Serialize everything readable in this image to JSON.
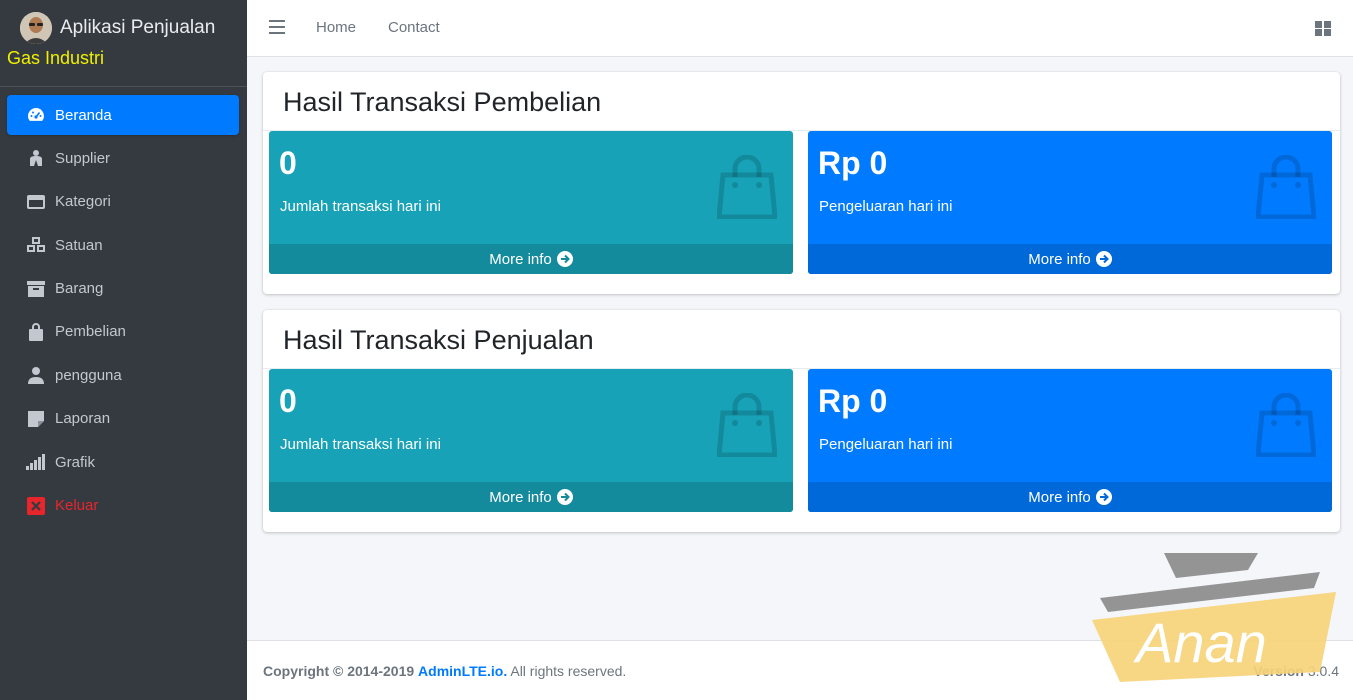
{
  "brand": {
    "title": "Aplikasi Penjualan",
    "subtitle": "Gas Industri"
  },
  "sidebar": {
    "items": [
      {
        "label": "Beranda",
        "icon": "tachometer-icon",
        "active": true
      },
      {
        "label": "Supplier",
        "icon": "user-tie-icon"
      },
      {
        "label": "Kategori",
        "icon": "window-icon"
      },
      {
        "label": "Satuan",
        "icon": "cubes-icon"
      },
      {
        "label": "Barang",
        "icon": "archive-box-icon"
      },
      {
        "label": "Pembelian",
        "icon": "shopping-bag-icon"
      },
      {
        "label": "pengguna",
        "icon": "user-icon"
      },
      {
        "label": "Laporan",
        "icon": "sticky-note-icon"
      },
      {
        "label": "Grafik",
        "icon": "signal-bars-icon"
      },
      {
        "label": "Keluar",
        "icon": "close-square-icon",
        "color": "#e8252b"
      }
    ]
  },
  "topbar": {
    "links": [
      "Home",
      "Contact"
    ]
  },
  "sections": [
    {
      "title": "Hasil Transaksi Pembelian",
      "boxes": [
        {
          "value": "0",
          "desc": "Jumlah transaksi hari ini",
          "footer": "More info",
          "color": "#17a2b8"
        },
        {
          "value": "Rp 0",
          "desc": "Pengeluaran hari ini",
          "footer": "More info",
          "color": "#007bff"
        }
      ]
    },
    {
      "title": "Hasil Transaksi Penjualan",
      "boxes": [
        {
          "value": "0",
          "desc": "Jumlah transaksi hari ini",
          "footer": "More info",
          "color": "#17a2b8"
        },
        {
          "value": "Rp 0",
          "desc": "Pengeluaran hari ini",
          "footer": "More info",
          "color": "#007bff"
        }
      ]
    }
  ],
  "footer": {
    "copyright": "Copyright © 2014-2019",
    "link": "AdminLTE.io.",
    "rights": "All rights reserved.",
    "version_label": "Version",
    "version": "3.0.4"
  },
  "watermark": {
    "text": "Anan"
  }
}
